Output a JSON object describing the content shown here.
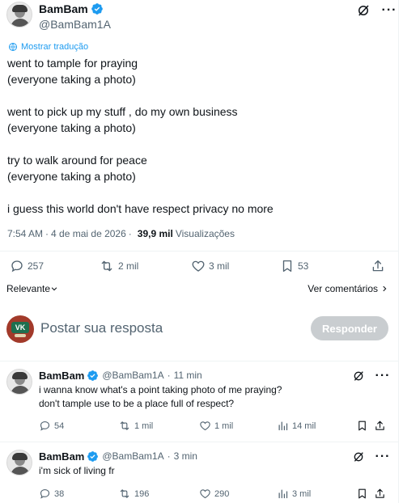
{
  "author": {
    "name": "BamBam",
    "handle": "@BamBam1A"
  },
  "translate_label": "Mostrar tradução",
  "tweet_paragraphs": [
    "went to tample for praying\n(everyone taking a photo)",
    "went to pick up my stuff , do my own business\n(everyone taking a photo)",
    "try to walk around for peace\n(everyone taking a photo)",
    "i guess this world don't have respect privacy no more"
  ],
  "meta": {
    "time": "7:54 AM",
    "date": "4 de mai de 2026",
    "views_count": "39,9 mil",
    "views_label": "Visualizações"
  },
  "actions": {
    "replies": "257",
    "reposts": "2 mil",
    "likes": "3 mil",
    "bookmarks": "53"
  },
  "sort": {
    "relevance_label": "Relevante",
    "view_quotes_label": "Ver comentários"
  },
  "reply_box": {
    "placeholder": "Postar sua resposta",
    "button_label": "Responder",
    "avatar_text": "VK"
  },
  "replies": [
    {
      "name": "BamBam",
      "handle": "@BamBam1A",
      "time": "11 min",
      "text": "i wanna know what's a point taking photo of me praying?\ndon't tample use to be a place full of respect?",
      "replies": "54",
      "reposts": "1 mil",
      "likes": "1 mil",
      "views": "14 mil"
    },
    {
      "name": "BamBam",
      "handle": "@BamBam1A",
      "time": "3 min",
      "text": "i'm sick of living fr",
      "replies": "38",
      "reposts": "196",
      "likes": "290",
      "views": "3 mil"
    }
  ],
  "colors": {
    "accent": "#1d9bf0",
    "muted": "#536471",
    "text": "#0f1419",
    "button_disabled": "#c9cdd0"
  },
  "icons": [
    "verified-badge-icon",
    "grok-icon",
    "more-icon",
    "translate-icon",
    "reply-icon",
    "repost-icon",
    "like-icon",
    "bookmark-icon",
    "share-icon",
    "views-icon",
    "chevron-down-icon",
    "chevron-right-icon"
  ]
}
